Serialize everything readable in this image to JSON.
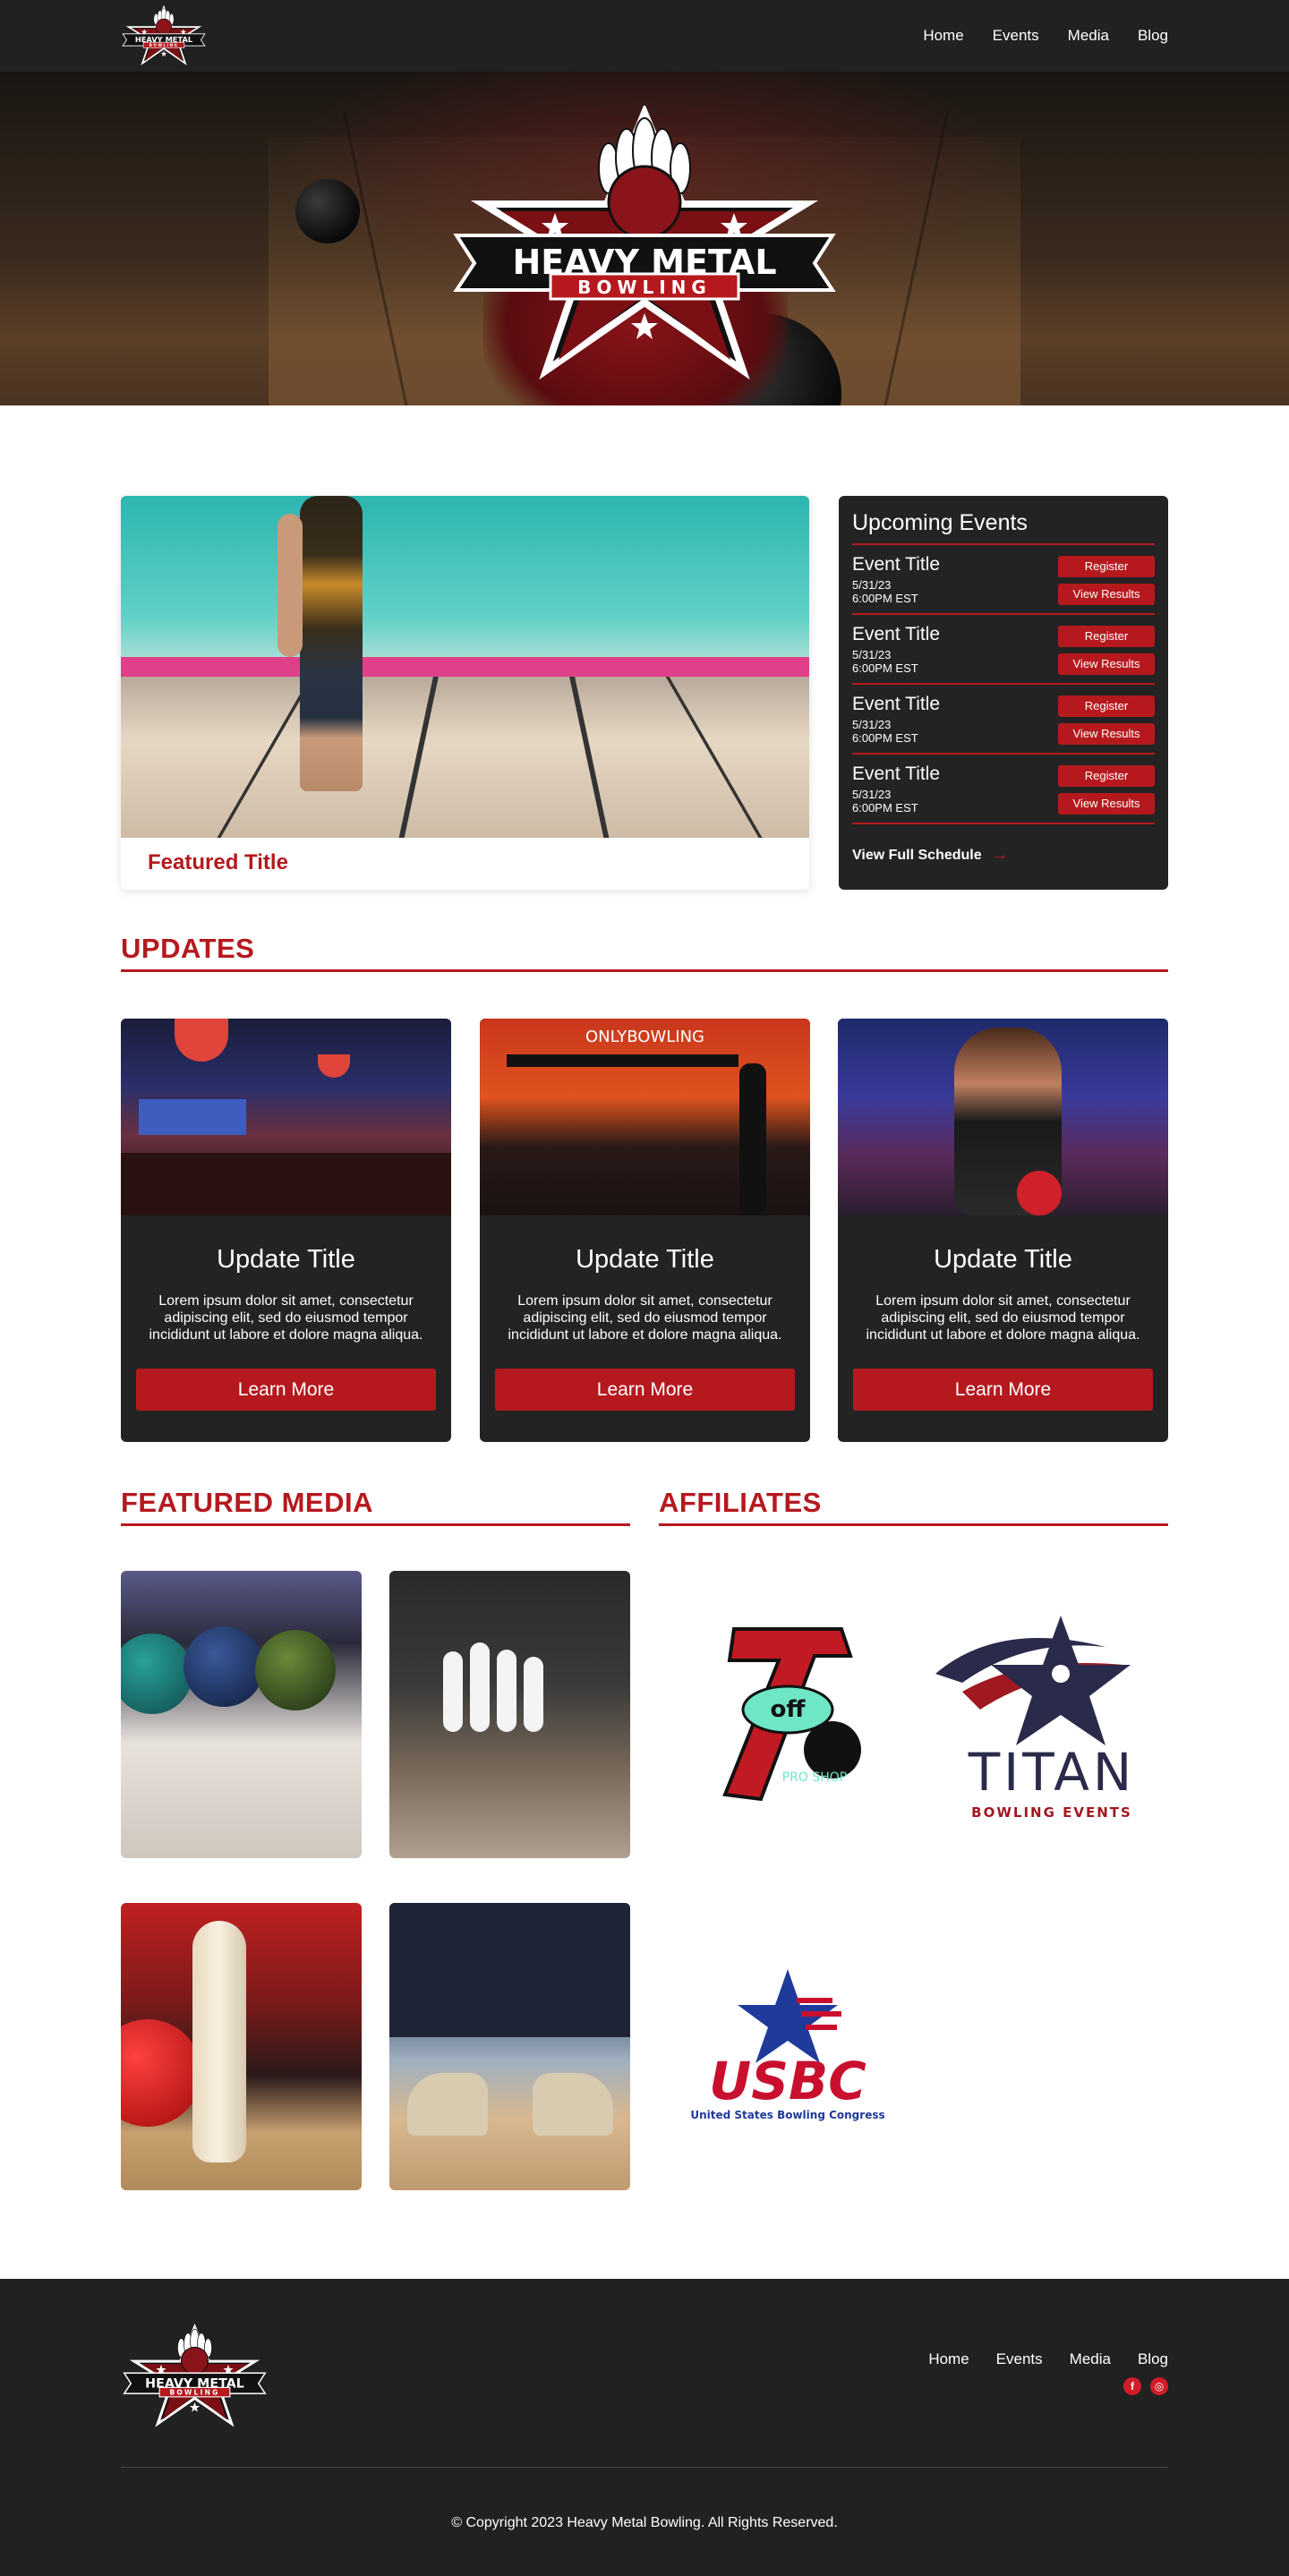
{
  "header": {
    "nav": [
      "Home",
      "Events",
      "Media",
      "Blog"
    ]
  },
  "brand": {
    "logo_line1": "HEAVY METAL",
    "logo_line2": "BOWLING",
    "accent": "#b5191e",
    "dark": "#212121"
  },
  "featured": {
    "title": "Featured Title"
  },
  "events": {
    "heading": "Upcoming Events",
    "items": [
      {
        "title": "Event Title",
        "date": "5/31/23",
        "time": "6:00PM EST",
        "register": "Register",
        "results": "View Results"
      },
      {
        "title": "Event Title",
        "date": "5/31/23",
        "time": "6:00PM EST",
        "register": "Register",
        "results": "View Results"
      },
      {
        "title": "Event Title",
        "date": "5/31/23",
        "time": "6:00PM EST",
        "register": "Register",
        "results": "View Results"
      },
      {
        "title": "Event Title",
        "date": "5/31/23",
        "time": "6:00PM EST",
        "register": "Register",
        "results": "View Results"
      }
    ],
    "schedule_link": "View Full Schedule"
  },
  "updates": {
    "heading": "UPDATES",
    "cards": [
      {
        "title": "Update Title",
        "body": "Lorem ipsum dolor sit amet, consectetur adipiscing elit, sed do eiusmod tempor incididunt ut labore et dolore magna aliqua.",
        "button": "Learn More"
      },
      {
        "title": "Update Title",
        "body": "Lorem ipsum dolor sit amet, consectetur adipiscing elit, sed do eiusmod tempor incididunt ut labore et dolore magna aliqua.",
        "button": "Learn More",
        "image_sign": "ONLYBOWLING"
      },
      {
        "title": "Update Title",
        "body": "Lorem ipsum dolor sit amet, consectetur adipiscing elit, sed do eiusmod tempor incididunt ut labore et dolore magna aliqua.",
        "button": "Learn More"
      }
    ]
  },
  "media": {
    "heading": "FEATURED MEDIA"
  },
  "affiliates": {
    "heading": "AFFILIATES",
    "logos": [
      {
        "name": "7 off pro shop",
        "text_main": "7",
        "text_sub": "off",
        "text_small": "PRO SHOP"
      },
      {
        "name": "titan",
        "text_main": "TITAN",
        "text_sub": "BOWLING EVENTS"
      },
      {
        "name": "usbc",
        "text_main": "USBC",
        "text_sub": "United States Bowling Congress"
      }
    ]
  },
  "footer": {
    "nav": [
      "Home",
      "Events",
      "Media",
      "Blog"
    ],
    "social": [
      "facebook-icon",
      "instagram-icon"
    ],
    "copyright": "© Copyright 2023 Heavy Metal Bowling. All Rights Reserved."
  }
}
